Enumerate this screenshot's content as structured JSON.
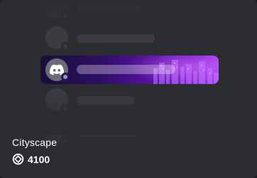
{
  "item": {
    "name": "Cityscape",
    "price": "4100",
    "currency_icon": "orb-icon"
  },
  "colors": {
    "card_background": "#2b2d31",
    "placeholder": "#3a3c41",
    "accent_purple": "#7b1fd1",
    "text": "#ffffff"
  }
}
